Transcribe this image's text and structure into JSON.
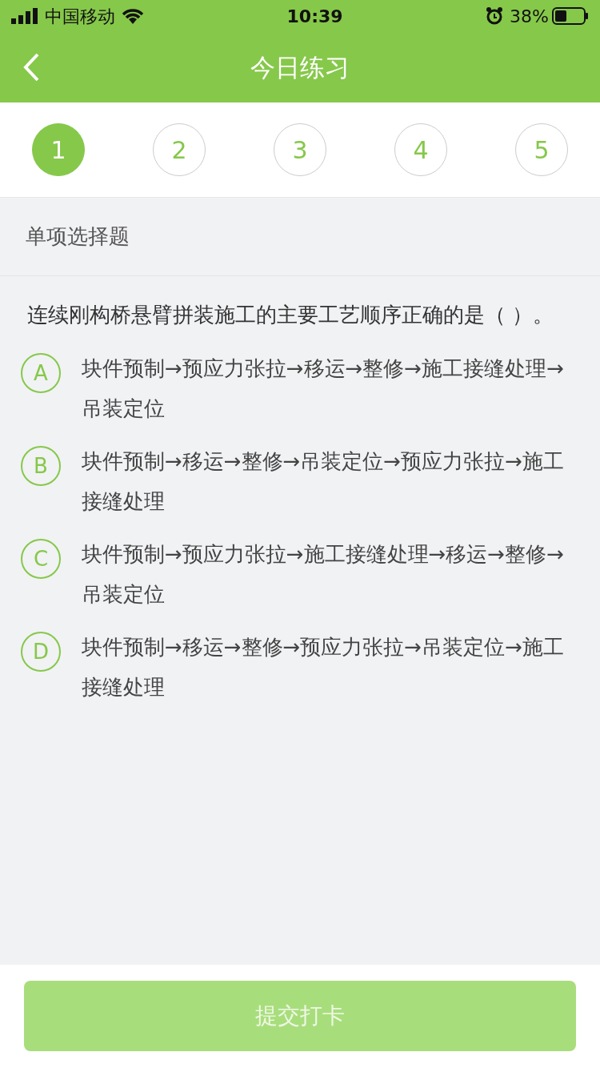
{
  "status_bar": {
    "carrier": "中国移动",
    "time": "10:39",
    "battery": "38%"
  },
  "header": {
    "title": "今日练习"
  },
  "steps": [
    {
      "label": "1",
      "selected": true
    },
    {
      "label": "2",
      "selected": false
    },
    {
      "label": "3",
      "selected": false
    },
    {
      "label": "4",
      "selected": false
    },
    {
      "label": "5",
      "selected": false
    }
  ],
  "section": "单项选择题",
  "question": "连续刚构桥悬臂拼装施工的主要工艺顺序正确的是（ ）。",
  "options": [
    {
      "letter": "A",
      "text": "块件预制→预应力张拉→移运→整修→施工接缝处理→吊装定位",
      "selected": false
    },
    {
      "letter": "B",
      "text": "块件预制→移运→整修→吊装定位→预应力张拉→施工接缝处理",
      "selected": false
    },
    {
      "letter": "C",
      "text": "块件预制→预应力张拉→施工接缝处理→移运→整修→吊装定位",
      "selected": false
    },
    {
      "letter": "D",
      "text": "块件预制→移运→整修→预应力张拉→吊装定位→施工接缝处理",
      "selected": false
    }
  ],
  "submit": {
    "label": "提交打卡",
    "disabled": true
  }
}
